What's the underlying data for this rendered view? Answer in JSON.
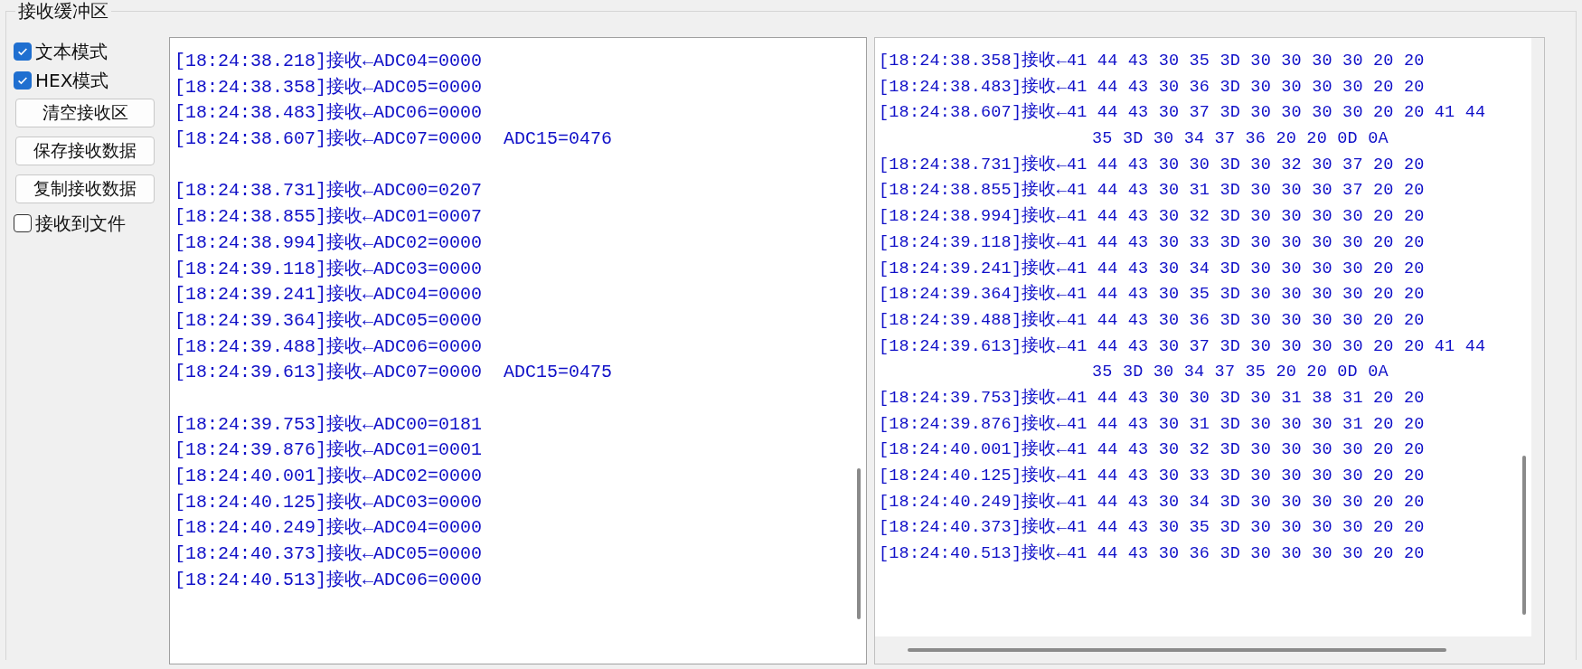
{
  "group_title": "接收缓冲区",
  "options": [
    {
      "kind": "checkbox",
      "label": "文本模式",
      "checked": true
    },
    {
      "kind": "checkbox",
      "label": "HEX模式",
      "checked": true
    },
    {
      "kind": "button",
      "label": "清空接收区"
    },
    {
      "kind": "button",
      "label": "保存接收数据"
    },
    {
      "kind": "button",
      "label": "复制接收数据"
    },
    {
      "kind": "checkbox",
      "label": "接收到文件",
      "checked": false
    }
  ],
  "text_log": {
    "lines": [
      {
        "kind": "entry",
        "text": "[18:24:38.218]接收←ADC04=0000"
      },
      {
        "kind": "entry",
        "text": "[18:24:38.358]接收←ADC05=0000"
      },
      {
        "kind": "entry",
        "text": "[18:24:38.483]接收←ADC06=0000"
      },
      {
        "kind": "entry",
        "text": "[18:24:38.607]接收←ADC07=0000  ADC15=0476"
      },
      {
        "kind": "blank"
      },
      {
        "kind": "entry",
        "text": "[18:24:38.731]接收←ADC00=0207"
      },
      {
        "kind": "entry",
        "text": "[18:24:38.855]接收←ADC01=0007"
      },
      {
        "kind": "entry",
        "text": "[18:24:38.994]接收←ADC02=0000"
      },
      {
        "kind": "entry",
        "text": "[18:24:39.118]接收←ADC03=0000"
      },
      {
        "kind": "entry",
        "text": "[18:24:39.241]接收←ADC04=0000"
      },
      {
        "kind": "entry",
        "text": "[18:24:39.364]接收←ADC05=0000"
      },
      {
        "kind": "entry",
        "text": "[18:24:39.488]接收←ADC06=0000"
      },
      {
        "kind": "entry",
        "text": "[18:24:39.613]接收←ADC07=0000  ADC15=0475"
      },
      {
        "kind": "blank"
      },
      {
        "kind": "entry",
        "text": "[18:24:39.753]接收←ADC00=0181"
      },
      {
        "kind": "entry",
        "text": "[18:24:39.876]接收←ADC01=0001"
      },
      {
        "kind": "entry",
        "text": "[18:24:40.001]接收←ADC02=0000"
      },
      {
        "kind": "entry",
        "text": "[18:24:40.125]接收←ADC03=0000"
      },
      {
        "kind": "entry",
        "text": "[18:24:40.249]接收←ADC04=0000"
      },
      {
        "kind": "entry",
        "text": "[18:24:40.373]接收←ADC05=0000"
      },
      {
        "kind": "entry",
        "text": "[18:24:40.513]接收←ADC06=0000"
      }
    ]
  },
  "hex_log": {
    "lines": [
      {
        "text": "[18:24:38.358]接收←41 44 43 30 35 3D 30 30 30 30 20 20"
      },
      {
        "text": "[18:24:38.483]接收←41 44 43 30 36 3D 30 30 30 30 20 20"
      },
      {
        "text": "[18:24:38.607]接收←41 44 43 30 37 3D 30 30 30 30 20 20 41 44",
        "continuation": "35 3D 30 34 37 36 20 20 0D 0A"
      },
      {
        "text": "[18:24:38.731]接收←41 44 43 30 30 3D 30 32 30 37 20 20"
      },
      {
        "text": "[18:24:38.855]接收←41 44 43 30 31 3D 30 30 30 37 20 20"
      },
      {
        "text": "[18:24:38.994]接收←41 44 43 30 32 3D 30 30 30 30 20 20"
      },
      {
        "text": "[18:24:39.118]接收←41 44 43 30 33 3D 30 30 30 30 20 20"
      },
      {
        "text": "[18:24:39.241]接收←41 44 43 30 34 3D 30 30 30 30 20 20"
      },
      {
        "text": "[18:24:39.364]接收←41 44 43 30 35 3D 30 30 30 30 20 20"
      },
      {
        "text": "[18:24:39.488]接收←41 44 43 30 36 3D 30 30 30 30 20 20"
      },
      {
        "text": "[18:24:39.613]接收←41 44 43 30 37 3D 30 30 30 30 20 20 41 44",
        "continuation": "35 3D 30 34 37 35 20 20 0D 0A"
      },
      {
        "text": "[18:24:39.753]接收←41 44 43 30 30 3D 30 31 38 31 20 20"
      },
      {
        "text": "[18:24:39.876]接收←41 44 43 30 31 3D 30 30 30 31 20 20"
      },
      {
        "text": "[18:24:40.001]接收←41 44 43 30 32 3D 30 30 30 30 20 20"
      },
      {
        "text": "[18:24:40.125]接收←41 44 43 30 33 3D 30 30 30 30 20 20"
      },
      {
        "text": "[18:24:40.249]接收←41 44 43 30 34 3D 30 30 30 30 20 20"
      },
      {
        "text": "[18:24:40.373]接收←41 44 43 30 35 3D 30 30 30 30 20 20"
      },
      {
        "text": "[18:24:40.513]接收←41 44 43 30 36 3D 30 30 30 30 20 20"
      }
    ]
  }
}
